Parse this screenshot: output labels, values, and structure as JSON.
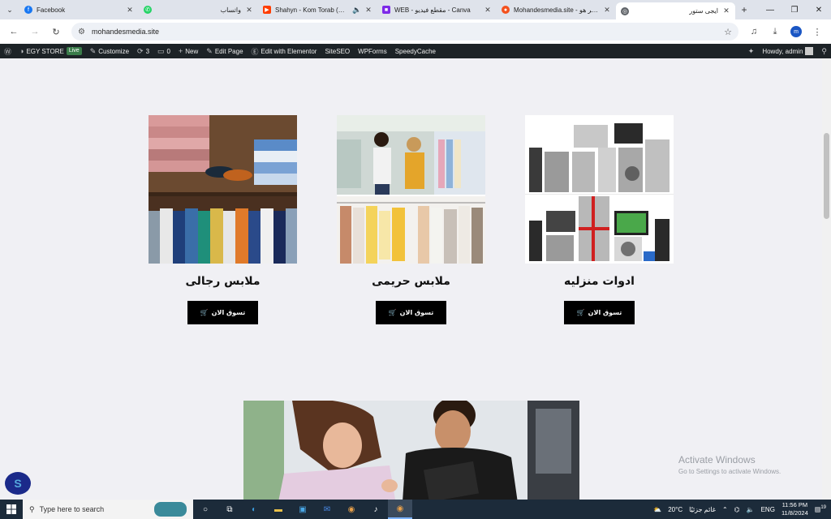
{
  "browser": {
    "tabs": [
      {
        "label": "Facebook",
        "icon": "facebook-icon",
        "color": "#1877f2",
        "active": false
      },
      {
        "label": "واتساب",
        "icon": "whatsapp-icon",
        "color": "#25d366",
        "active": false
      },
      {
        "label": "Shahyn - Kom Torab (Ward",
        "icon": "youtube-icon",
        "color": "#ff3d00",
        "active": false
      },
      {
        "label": "WEB - مقطع فيديو - Canva",
        "icon": "canva-icon",
        "color": "#7d2ae8",
        "active": false
      },
      {
        "label": "Mohandesmedia.site - بوستر هو",
        "icon": "site-icon",
        "color": "#f4511e",
        "active": false
      },
      {
        "label": "ايجى ستور",
        "icon": "globe-icon",
        "color": "#5f6368",
        "active": true
      }
    ],
    "url": "mohandesmedia.site"
  },
  "adminbar": {
    "site": "EGY STORE",
    "live": "Live",
    "customize": "Customize",
    "updates": "3",
    "comments": "0",
    "new": "New",
    "edit_page": "Edit Page",
    "elementor": "Edit with Elementor",
    "siteseo": "SiteSEO",
    "wpforms": "WPForms",
    "speedycache": "SpeedyCache",
    "howdy": "Howdy, admin"
  },
  "categories": [
    {
      "title": "ملابس رجالى",
      "button": "تسوق الان"
    },
    {
      "title": "ملابس حريمى",
      "button": "تسوق الان"
    },
    {
      "title": "ادوات منزليه",
      "button": "تسوق الان"
    }
  ],
  "watermark": {
    "line1": "Activate Windows",
    "line2": "Go to Settings to activate Windows."
  },
  "taskbar": {
    "search_placeholder": "Type here to search",
    "weather": "20°C",
    "weather_desc": "غائم جزئيًا",
    "lang": "ENG",
    "time": "11:56 PM",
    "date": "11/8/2024",
    "notif_count": "19"
  }
}
